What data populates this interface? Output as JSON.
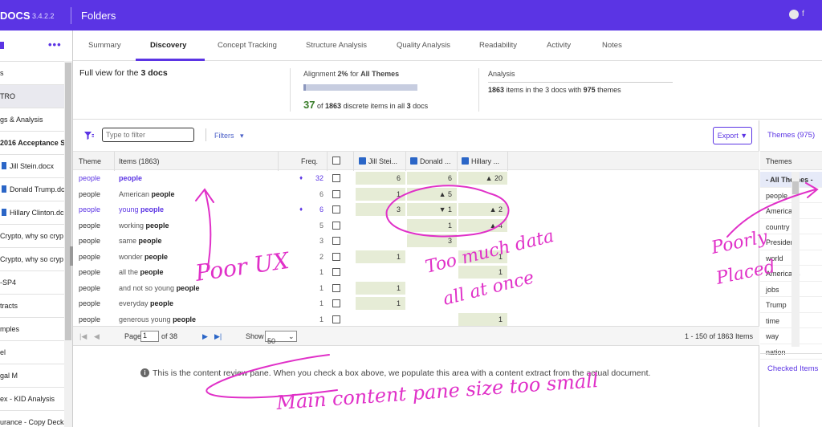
{
  "header": {
    "brand": "DOCS",
    "version": "3.4.2.2",
    "title": "Folders",
    "user": "f"
  },
  "sidebar": {
    "items": [
      {
        "label": "s",
        "bold": false,
        "doc": false,
        "selected": false
      },
      {
        "label": "TRO",
        "bold": false,
        "doc": false,
        "selected": true
      },
      {
        "label": "gs & Analysis",
        "bold": false,
        "doc": false,
        "selected": false
      },
      {
        "label": "2016 Acceptance S",
        "bold": true,
        "doc": false,
        "selected": false
      },
      {
        "label": "Jill Stein.docx",
        "bold": false,
        "doc": true,
        "selected": false
      },
      {
        "label": "Donald Trump.dc",
        "bold": false,
        "doc": true,
        "selected": false
      },
      {
        "label": "Hillary Clinton.dc",
        "bold": false,
        "doc": true,
        "selected": false
      },
      {
        "label": "Crypto, why so cryp",
        "bold": false,
        "doc": false,
        "selected": false
      },
      {
        "label": "Crypto, why so cryp",
        "bold": false,
        "doc": false,
        "selected": false
      },
      {
        "label": "-SP4",
        "bold": false,
        "doc": false,
        "selected": false
      },
      {
        "label": "tracts",
        "bold": false,
        "doc": false,
        "selected": false
      },
      {
        "label": "mples",
        "bold": false,
        "doc": false,
        "selected": false
      },
      {
        "label": "el",
        "bold": false,
        "doc": false,
        "selected": false
      },
      {
        "label": "gal M",
        "bold": false,
        "doc": false,
        "selected": false
      },
      {
        "label": "ex - KID Analysis",
        "bold": false,
        "doc": false,
        "selected": false
      },
      {
        "label": "urance - Copy Decks",
        "bold": false,
        "doc": false,
        "selected": false
      }
    ]
  },
  "tabs": [
    "Summary",
    "Discovery",
    "Concept Tracking",
    "Structure Analysis",
    "Quality Analysis",
    "Readability",
    "Activity",
    "Notes"
  ],
  "summary": {
    "full_view_prefix": "Full view for the",
    "full_view_count": "3 docs",
    "alignment_prefix": "Alignment",
    "alignment_pct": "2%",
    "alignment_mid": "for",
    "alignment_scope": "All Themes",
    "alignment_fraction": 0.02,
    "aligned_count": "37",
    "aligned_of": "of",
    "aligned_total": "1863",
    "aligned_mid": "discrete items in all",
    "aligned_docs": "3",
    "aligned_suffix": "docs",
    "analysis_label": "Analysis",
    "analysis_items": "1863",
    "analysis_mid": "items in the 3 docs with",
    "analysis_themes": "975",
    "analysis_suffix": "themes"
  },
  "toolbar": {
    "filter_placeholder": "Type to filter",
    "filters_label": "Filters",
    "export_label": "Export"
  },
  "table": {
    "headers": {
      "theme": "Theme",
      "items": "Items (1863)",
      "freq": "Freq.",
      "doc1": "Jill Stei...",
      "doc2": "Donald ...",
      "doc3": "Hillary ..."
    },
    "rows": [
      {
        "theme": "people",
        "pre": "",
        "kw": "people",
        "freq": "32",
        "hi": true,
        "d1": "6",
        "d2": "6",
        "d3": "▲ 20"
      },
      {
        "theme": "people",
        "pre": "American ",
        "kw": "people",
        "freq": "6",
        "hi": false,
        "d1": "1",
        "d2": "▲ 5",
        "d3": ""
      },
      {
        "theme": "people",
        "pre": "young ",
        "kw": "people",
        "freq": "6",
        "hi": true,
        "d1": "3",
        "d2": "▼ 1",
        "d3": "▲ 2"
      },
      {
        "theme": "people",
        "pre": "working ",
        "kw": "people",
        "freq": "5",
        "hi": false,
        "d1": "",
        "d2": "1",
        "d3": "▲ 4"
      },
      {
        "theme": "people",
        "pre": "same ",
        "kw": "people",
        "freq": "3",
        "hi": false,
        "d1": "",
        "d2": "3",
        "d3": ""
      },
      {
        "theme": "people",
        "pre": "wonder ",
        "kw": "people",
        "freq": "2",
        "hi": false,
        "d1": "1",
        "d2": "",
        "d3": "1"
      },
      {
        "theme": "people",
        "pre": "all the ",
        "kw": "people",
        "freq": "1",
        "hi": false,
        "d1": "",
        "d2": "",
        "d3": "1"
      },
      {
        "theme": "people",
        "pre": "and not so young ",
        "kw": "people",
        "freq": "1",
        "hi": false,
        "d1": "1",
        "d2": "",
        "d3": ""
      },
      {
        "theme": "people",
        "pre": "everyday ",
        "kw": "people",
        "freq": "1",
        "hi": false,
        "d1": "1",
        "d2": "",
        "d3": ""
      },
      {
        "theme": "people",
        "pre": "generous young ",
        "kw": "people",
        "freq": "1",
        "hi": false,
        "d1": "",
        "d2": "",
        "d3": "1"
      }
    ]
  },
  "pager": {
    "page_label": "Page",
    "page_value": "1",
    "of_label": "of 38",
    "show_label": "Show",
    "show_value": "50",
    "range": "1 - 150 of 1863 Items"
  },
  "content_pane": {
    "info_icon": "i",
    "text": "This is the content review pane. When you check a box above, we populate this area with a content extract from the actual document."
  },
  "themes_panel": {
    "tab_label": "Themes (975)",
    "header": "Themes",
    "items": [
      "- All Themes -",
      "people",
      "America",
      "country",
      "President",
      "world",
      "Americans",
      "jobs",
      "Trump",
      "time",
      "way",
      "nation"
    ],
    "checked_items": "Checked Items"
  },
  "annotations": {
    "poor_ux": "Poor UX",
    "too_much_1": "Too much data",
    "too_much_2": "all at once",
    "poorly": "Poorly",
    "placed": "Placed",
    "main_content": "Main content pane size too small"
  },
  "colors": {
    "accent": "#5b34e4",
    "annotation": "#e030c8",
    "cell_bg": "#e6ecd6"
  }
}
